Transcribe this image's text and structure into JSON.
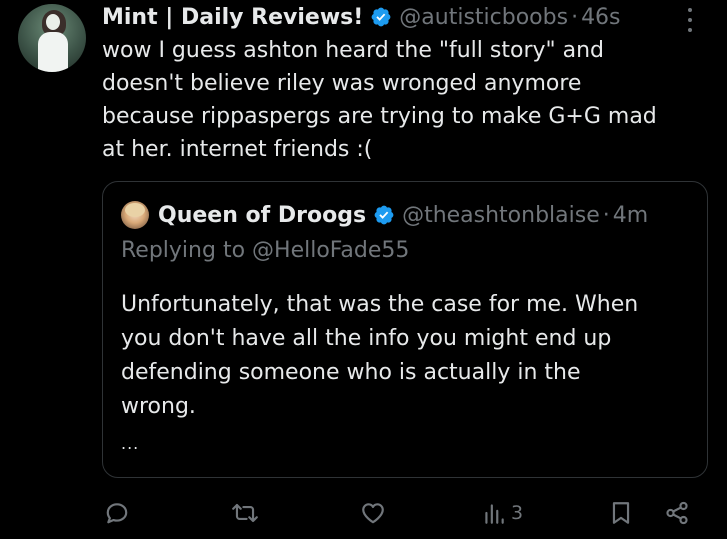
{
  "tweet": {
    "display_name": "Mint | Daily Reviews!",
    "handle": "@autisticboobs",
    "separator": "·",
    "time": "46s",
    "body_lines": [
      "wow I guess ashton heard the \"full story\" and",
      "doesn't believe riley was wronged anymore",
      "because rippaspergs are trying to make G+G mad",
      "at her. internet friends :("
    ]
  },
  "quote": {
    "display_name": "Queen of Droogs",
    "handle": "@theashtonblaise",
    "separator": "·",
    "time": "4m",
    "replying_to": "Replying to @HelloFade55",
    "body_lines": [
      "Unfortunately, that was the case for me. When",
      "you don't have all the info you might end up",
      "defending someone who is actually in the",
      "wrong."
    ],
    "truncation": "..."
  },
  "actions": {
    "views_count": "3"
  },
  "icons": {
    "verified": "verified-badge-icon",
    "more": "more-options-icon",
    "reply": "reply-icon",
    "retweet": "retweet-icon",
    "like": "like-icon",
    "views": "views-icon",
    "bookmark": "bookmark-icon",
    "share": "share-icon"
  },
  "colors": {
    "background": "#000000",
    "text_primary": "#e7e9ea",
    "text_secondary": "#71767b",
    "verified": "#1d9bf0",
    "border": "#2f3336"
  }
}
